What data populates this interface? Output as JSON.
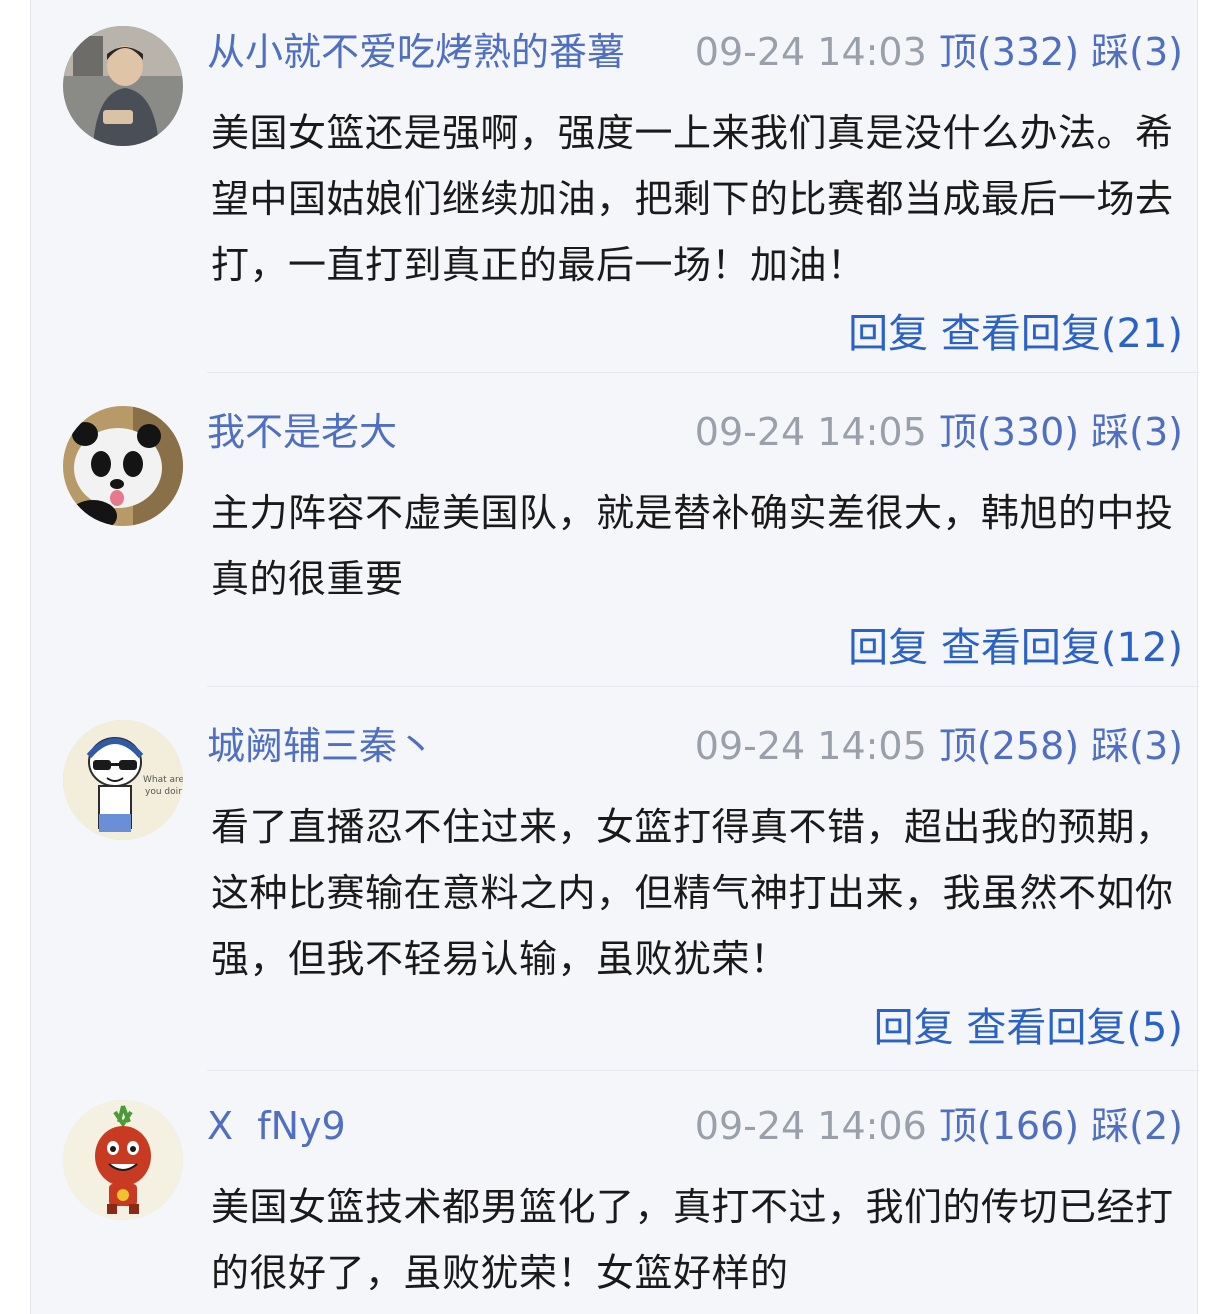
{
  "comments": [
    {
      "username": "从小就不爱吃烤熟的番薯",
      "time": "09-24 14:03",
      "up": "顶(332)",
      "down": "踩(3)",
      "text": "美国女篮还是强啊，强度一上来我们真是没什么办法。希望中国姑娘们继续加油，把剩下的比赛都当成最后一场去打，一直打到真正的最后一场！加油！",
      "reply": "回复",
      "view_replies": "查看回复(21)"
    },
    {
      "username": "我不是老大",
      "time": "09-24 14:05",
      "up": "顶(330)",
      "down": "踩(3)",
      "text": "主力阵容不虚美国队，就是替补确实差很大，韩旭的中投真的很重要",
      "reply": "回复",
      "view_replies": "查看回复(12)"
    },
    {
      "username": "城阙辅三秦丶",
      "time": "09-24 14:05",
      "up": "顶(258)",
      "down": "踩(3)",
      "text": "看了直播忍不住过来，女篮打得真不错，超出我的预期，这种比赛输在意料之内，但精气神打出来，我虽然不如你强，但我不轻易认输，虽败犹荣！",
      "reply": "回复",
      "view_replies": "查看回复(5)"
    },
    {
      "username": "X  fNy9",
      "time": "09-24 14:06",
      "up": "顶(166)",
      "down": "踩(2)",
      "text": "美国女篮技术都男篮化了，真打不过，我们的传切已经打的很好了，虽败犹荣！女篮好样的"
    }
  ]
}
